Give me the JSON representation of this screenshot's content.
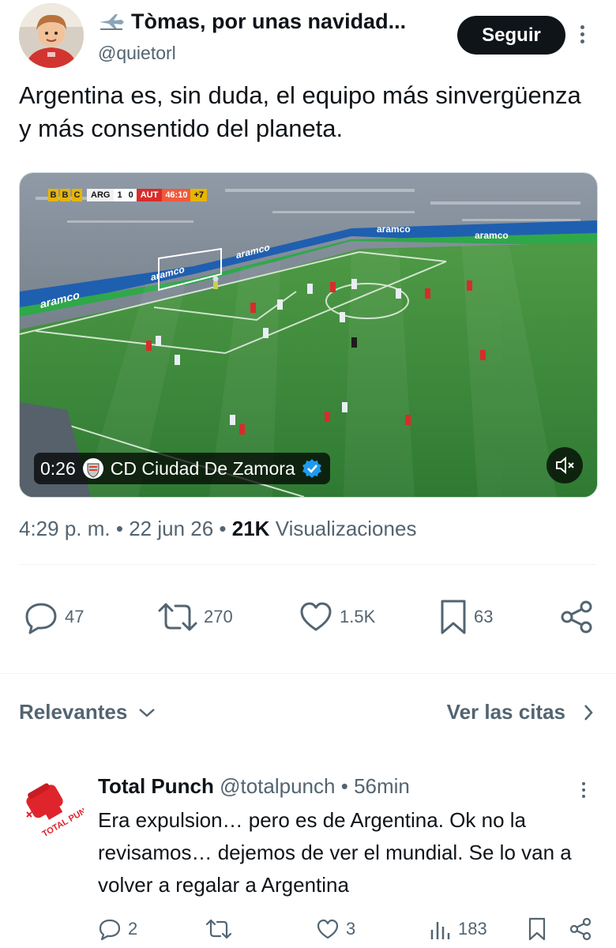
{
  "tweet": {
    "author": {
      "display_name": "Tòmas, por unas navidad...",
      "handle": "@quietorl"
    },
    "follow_label": "Seguir",
    "text": "Argentina es, sin duda, el equipo más sinvergüenza y más consentido del planeta.",
    "media": {
      "scoreboard": {
        "broadcaster": [
          "B",
          "B",
          "C"
        ],
        "home": "ARG",
        "score_home": "1",
        "score_away": "0",
        "away": "AUT",
        "clock": "46:10",
        "added": "+7"
      },
      "pitch_ads": [
        "aramco",
        "aramco",
        "aramco",
        "aramco",
        "aramco"
      ],
      "video_time": "0:26",
      "source_account": "CD Ciudad De Zamora"
    },
    "meta": {
      "time": "4:29 p. m.",
      "separator": "•",
      "date": "22 jun 26",
      "views_count": "21K",
      "views_label": "Visualizaciones"
    },
    "stats": {
      "replies": "47",
      "reposts": "270",
      "likes": "1.5K",
      "bookmarks": "63"
    }
  },
  "sort": {
    "label": "Relevantes",
    "quotes_label": "Ver las citas"
  },
  "reply": {
    "display_name": "Total Punch",
    "handle": "@totalpunch",
    "separator": "•",
    "time": "56min",
    "avatar_text": "TOTAL PUNCH",
    "text": "Era expulsion… pero es de Argentina.   Ok no la revisamos… dejemos de ver el mundial. Se lo van a volver a regalar a Argentina",
    "stats": {
      "replies": "2",
      "likes": "3",
      "views": "183"
    }
  },
  "colors": {
    "text_primary": "#0f1419",
    "text_secondary": "#536471",
    "verified_blue": "#1d9bf0",
    "pitch_green": "#3f8a3a",
    "punch_red": "#e0242c"
  }
}
